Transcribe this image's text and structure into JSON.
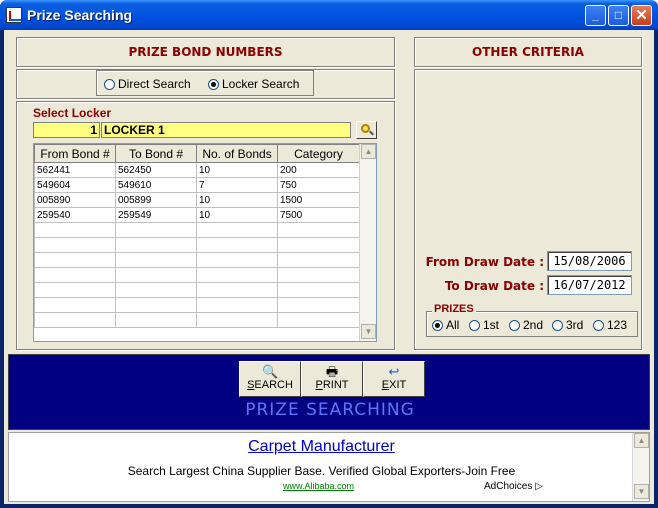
{
  "window": {
    "title": "Prize Searching",
    "minimize": "_",
    "maximize": "□",
    "close": "✕"
  },
  "left_panel": {
    "header": "PRIZE BOND NUMBERS",
    "search_mode": {
      "options": [
        "Direct Search",
        "Locker Search"
      ],
      "selected": "Locker Search"
    },
    "select_locker_label": "Select Locker",
    "locker_number": "1",
    "locker_name": "LOCKER 1",
    "grid": {
      "columns": [
        "From Bond #",
        "To Bond #",
        "No. of Bonds",
        "Category"
      ],
      "rows": [
        [
          "562441",
          "562450",
          "10",
          "200"
        ],
        [
          "549604",
          "549610",
          "7",
          "750"
        ],
        [
          "005890",
          "005899",
          "10",
          "1500"
        ],
        [
          "259540",
          "259549",
          "10",
          "7500"
        ]
      ]
    }
  },
  "right_panel": {
    "header": "OTHER CRITERIA",
    "from_draw_date_label": "From Draw Date :",
    "from_draw_date": "15/08/2006",
    "to_draw_date_label": "To Draw Date :",
    "to_draw_date": "16/07/2012",
    "prizes": {
      "title": "PRIZES",
      "options": [
        "All",
        "1st",
        "2nd",
        "3rd",
        "123"
      ],
      "selected": "All"
    }
  },
  "actions": {
    "search": "SEARCH",
    "print": "PRINT",
    "exit": "EXIT"
  },
  "banner": "PRIZE SEARCHING",
  "ad": {
    "headline": "Carpet Manufacturer",
    "body": "Search Largest China Supplier Base. Verified Global Exporters-Join Free",
    "url": "www.Alibaba.com",
    "adchoices": "AdChoices"
  },
  "colors": {
    "title_bar": "#0054e3",
    "panel_header": "#8b0000",
    "banner_bg": "#000080",
    "field_highlight": "#ffff80"
  }
}
